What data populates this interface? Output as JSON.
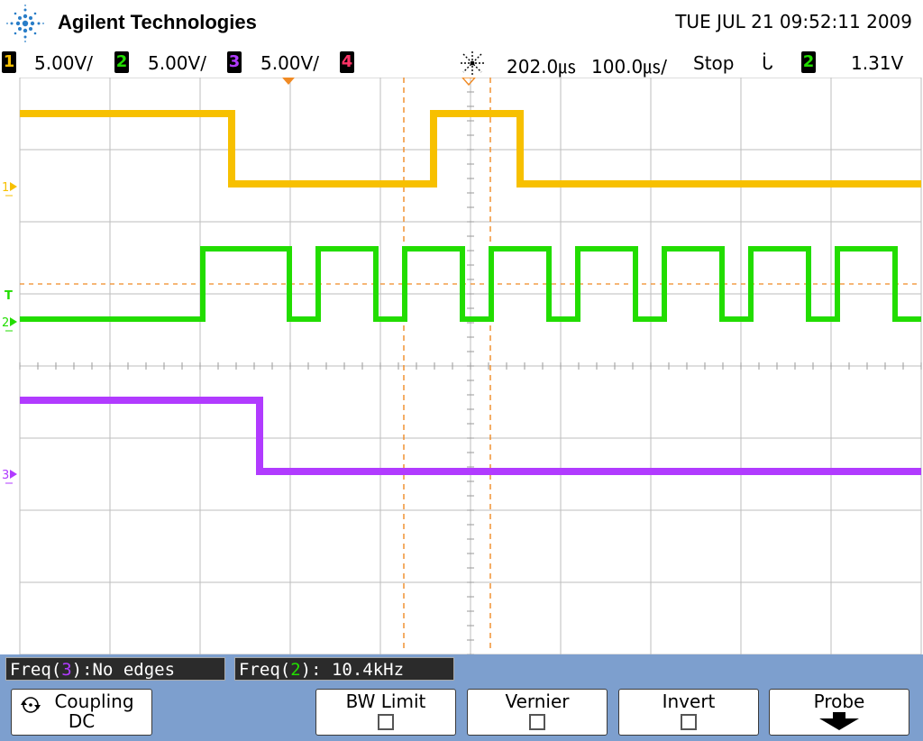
{
  "header": {
    "brand": "Agilent Technologies",
    "datetime": "TUE JUL 21 09:52:11 2009",
    "logo_icon": "agilent-spark-icon"
  },
  "status": {
    "channels": [
      {
        "num": "1",
        "scale": "5.00V/",
        "color": "#f7c000"
      },
      {
        "num": "2",
        "scale": "5.00V/",
        "color": "#22dd00"
      },
      {
        "num": "3",
        "scale": "5.00V/",
        "color": "#b13bff"
      },
      {
        "num": "4",
        "scale": "",
        "color": "#ff3366"
      }
    ],
    "run_icon": "acquisition-spark-icon",
    "delay": "202.0㎲",
    "timebase": "100.0㎲/",
    "run_state": "Stop",
    "trigger_slope": "ᒑ",
    "trigger_channel": "2",
    "trigger_level": "1.31V"
  },
  "screen": {
    "markers": {
      "ch1": "1",
      "ch2": "2",
      "ch3": "3",
      "trigger": "T"
    },
    "colors": {
      "ch1": "#f7c000",
      "ch2": "#22dd00",
      "ch3": "#b13bff",
      "cursor": "#f08a24",
      "grid": "#bdbdbd"
    }
  },
  "measurements": {
    "m1_prefix": "Freq(",
    "m1_channel": "3",
    "m1_suffix": "):No edges",
    "m2_prefix": "Freq(",
    "m2_channel": "2",
    "m2_suffix": "): 10.4kHz"
  },
  "softkeys": {
    "coupling_label": "Coupling",
    "coupling_value": "DC",
    "bw_limit_label": "BW Limit",
    "vernier_label": "Vernier",
    "invert_label": "Invert",
    "probe_label": "Probe"
  }
}
